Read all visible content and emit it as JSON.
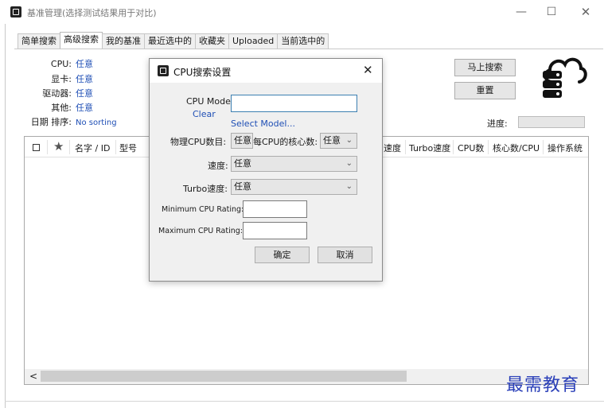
{
  "window": {
    "title": "基准管理(选择测试结果用于对比)",
    "minimize": "—",
    "maximize": "☐",
    "close": "✕"
  },
  "tabs": [
    "简单搜索",
    "高级搜索",
    "我的基准",
    "最近选中的",
    "收藏夹",
    "Uploaded",
    "当前选中的"
  ],
  "filters": {
    "cpu_label": "CPU:",
    "cpu_value": "任意",
    "gpu_label": "显卡:",
    "gpu_value": "任意",
    "driver_label": "驱动器:",
    "driver_value": "任意",
    "other_label": "其他:",
    "other_value": "任意",
    "date_sort_label": "日期  排序:",
    "sort_value": "No sorting"
  },
  "buttons": {
    "search_now": "马上搜索",
    "reset": "重置"
  },
  "progress": {
    "label": "进度:",
    "value": 0
  },
  "table": {
    "columns_left": [
      "名字 / ID",
      "型号"
    ],
    "columns_right": [
      "速度",
      "Turbo速度",
      "CPU数",
      "核心数/CPU",
      "操作系统"
    ]
  },
  "scrollbar": {
    "left_arrow": "<"
  },
  "dialog": {
    "title": "CPU搜索设置",
    "close": "✕",
    "cpu_model_label": "CPU Model",
    "clear_link": "Clear",
    "cpu_model_value": "",
    "select_model_link": "Select Model...",
    "physical_cpu_label": "物理CPU数目:",
    "physical_cpu_value": "任意",
    "cores_per_cpu_label": "每CPU的核心数:",
    "cores_per_cpu_value": "任意",
    "speed_label": "速度:",
    "speed_value": "任意",
    "turbo_label": "Turbo速度:",
    "turbo_value": "任意",
    "min_rating_label": "Minimum CPU Rating:",
    "min_rating_value": "",
    "max_rating_label": "Maximum CPU Rating:",
    "max_rating_value": "",
    "ok": "确定",
    "cancel": "取消"
  },
  "watermark": "最需教育",
  "colors": {
    "link": "#1f4fb5",
    "watermark": "#2a3fb8",
    "focus": "#3c7fb1"
  },
  "icons": [
    "app-icon",
    "close-icon",
    "star-icon",
    "cloud-database-icon",
    "chevron-down-icon",
    "chevron-left-icon"
  ]
}
